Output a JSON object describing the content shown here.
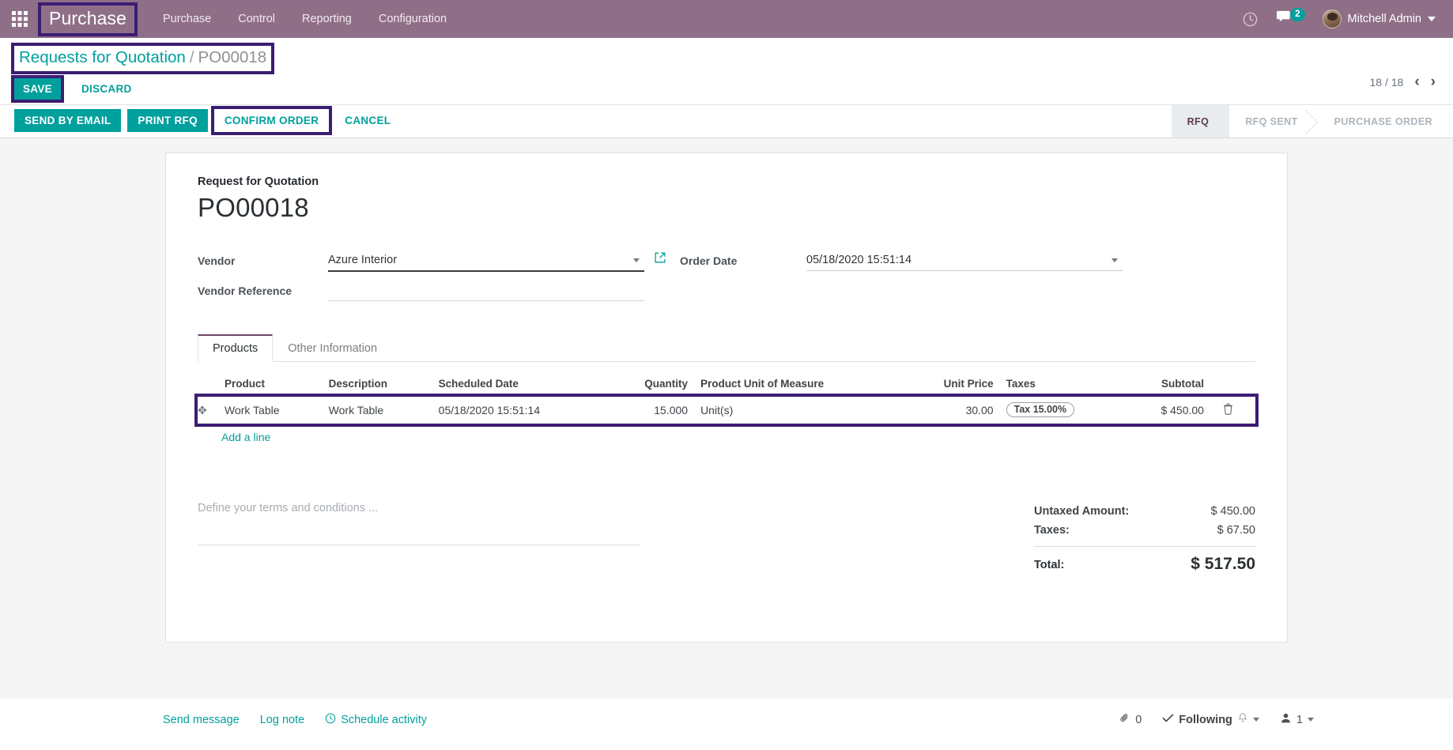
{
  "navbar": {
    "apps_icon": "apps-grid-icon",
    "brand": "Purchase",
    "menu": [
      {
        "label": "Purchase"
      },
      {
        "label": "Control"
      },
      {
        "label": "Reporting"
      },
      {
        "label": "Configuration"
      }
    ],
    "clock_icon": "clock-icon",
    "chat_icon": "chat-bubble-icon",
    "chat_count": "2",
    "user_name": "Mitchell Admin"
  },
  "control_panel": {
    "breadcrumb_root": "Requests for Quotation",
    "breadcrumb_sep": "/",
    "breadcrumb_current": "PO00018",
    "save_label": "SAVE",
    "discard_label": "DISCARD",
    "pager_text": "18 / 18",
    "prev_icon": "chevron-left-icon",
    "next_icon": "chevron-right-icon"
  },
  "action_bar": {
    "buttons": [
      {
        "label": "SEND BY EMAIL",
        "style": "filled"
      },
      {
        "label": "PRINT RFQ",
        "style": "filled"
      },
      {
        "label": "CONFIRM ORDER",
        "style": "outline"
      },
      {
        "label": "CANCEL",
        "style": "link"
      }
    ],
    "statuses": [
      {
        "label": "RFQ",
        "active": true
      },
      {
        "label": "RFQ SENT",
        "active": false
      },
      {
        "label": "PURCHASE ORDER",
        "active": false
      }
    ]
  },
  "form": {
    "kicker": "Request for Quotation",
    "title": "PO00018",
    "vendor_label": "Vendor",
    "vendor_value": "Azure Interior",
    "vendor_ext_icon": "external-link-icon",
    "order_date_label": "Order Date",
    "order_date_value": "05/18/2020 15:51:14",
    "vendor_ref_label": "Vendor Reference",
    "vendor_ref_value": "",
    "vendor_ref_placeholder": ""
  },
  "notebook": {
    "tabs": [
      {
        "label": "Products",
        "active": true
      },
      {
        "label": "Other Information",
        "active": false
      }
    ]
  },
  "lines_table": {
    "columns": [
      "Product",
      "Description",
      "Scheduled Date",
      "Quantity",
      "Product Unit of Measure",
      "Unit Price",
      "Taxes",
      "Subtotal"
    ],
    "rows": [
      {
        "drag_icon": "drag-handle-icon",
        "product": "Work Table",
        "description": "Work Table",
        "scheduled_date": "05/18/2020 15:51:14",
        "quantity": "15.000",
        "uom": "Unit(s)",
        "unit_price": "30.00",
        "taxes": "Tax 15.00%",
        "subtotal": "$ 450.00",
        "delete_icon": "trash-icon"
      }
    ],
    "add_line_label": "Add a line"
  },
  "terms": {
    "placeholder": "Define your terms and conditions ..."
  },
  "totals": {
    "untaxed_label": "Untaxed Amount:",
    "untaxed_value": "$ 450.00",
    "taxes_label": "Taxes:",
    "taxes_value": "$ 67.50",
    "total_label": "Total:",
    "total_value": "$ 517.50"
  },
  "chatter": {
    "send_message": "Send message",
    "log_note": "Log note",
    "schedule_activity": "Schedule activity",
    "schedule_icon": "clock-icon",
    "attachment_icon": "paperclip-icon",
    "attachment_count": "0",
    "following_icon": "check-icon",
    "following_label": "Following",
    "bell_icon": "bell-icon",
    "followers_icon": "user-icon",
    "followers_count": "1"
  },
  "colors": {
    "brand_purple": "#8f6f87",
    "accent_teal": "#00a09d",
    "highlight_indigo": "#3b1d72",
    "tab_active_purple": "#71476b"
  }
}
